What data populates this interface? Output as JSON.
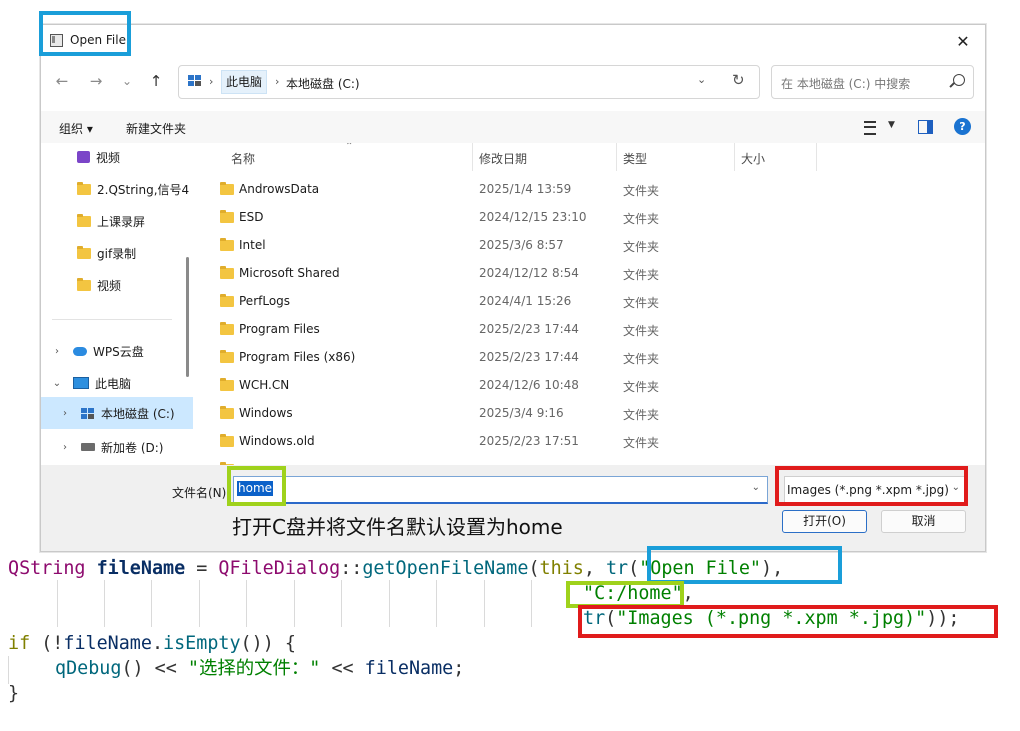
{
  "colors": {
    "highlight_blue": "#1a9ed9",
    "highlight_green": "#9fd21c",
    "highlight_red": "#e01b1b",
    "accent": "#0b61c9"
  },
  "dialog": {
    "title": "Open File",
    "close_glyph": "✕",
    "nav": {
      "back": "←",
      "forward": "→",
      "recent": "⌄",
      "up": "↑"
    },
    "address": {
      "crumbs": [
        "此电脑",
        "本地磁盘 (C:)"
      ],
      "separator": "›",
      "refresh": "↻",
      "dropdown": "⌄"
    },
    "search": {
      "placeholder": "在 本地磁盘 (C:) 中搜索"
    },
    "toolbar": {
      "organize": "组织 ▾",
      "new_folder": "新建文件夹",
      "help": "?"
    },
    "nav_pane": {
      "quick": [
        {
          "label": "视频",
          "icon": "video-icon",
          "pinned": true
        },
        {
          "label": "2.QString,信号4",
          "icon": "folder-icon"
        },
        {
          "label": "上课录屏",
          "icon": "folder-icon"
        },
        {
          "label": "gif录制",
          "icon": "folder-icon"
        },
        {
          "label": "视频",
          "icon": "folder-icon"
        }
      ],
      "tree": [
        {
          "label": "WPS云盘",
          "icon": "cloud-icon",
          "expander": "›"
        },
        {
          "label": "此电脑",
          "icon": "pc-icon",
          "expander": "⌄"
        },
        {
          "label": "本地磁盘 (C:)",
          "icon": "drive-c-icon",
          "expander": "›",
          "selected": true
        },
        {
          "label": "新加卷 (D:)",
          "icon": "drive-icon",
          "expander": "›"
        }
      ]
    },
    "columns": {
      "name": "名称",
      "date": "修改日期",
      "type": "类型",
      "size": "大小"
    },
    "files": [
      {
        "name": "AndrowsData",
        "date": "2025/1/4 13:59",
        "type": "文件夹"
      },
      {
        "name": "ESD",
        "date": "2024/12/15 23:10",
        "type": "文件夹"
      },
      {
        "name": "Intel",
        "date": "2025/3/6 8:57",
        "type": "文件夹"
      },
      {
        "name": "Microsoft Shared",
        "date": "2024/12/12 8:54",
        "type": "文件夹"
      },
      {
        "name": "PerfLogs",
        "date": "2024/4/1 15:26",
        "type": "文件夹"
      },
      {
        "name": "Program Files",
        "date": "2025/2/23 17:44",
        "type": "文件夹"
      },
      {
        "name": "Program Files (x86)",
        "date": "2025/2/23 17:44",
        "type": "文件夹"
      },
      {
        "name": "WCH.CN",
        "date": "2024/12/6 10:48",
        "type": "文件夹"
      },
      {
        "name": "Windows",
        "date": "2025/3/4 9:16",
        "type": "文件夹"
      },
      {
        "name": "Windows.old",
        "date": "2025/2/23 17:51",
        "type": "文件夹"
      }
    ],
    "filename_label": "文件名(N):",
    "filename_value": "home",
    "filter_value": "Images (*.png *.xpm *.jpg)",
    "open_button": "打开(O)",
    "cancel_button": "取消",
    "caption": "打开C盘并将文件名默认设置为home"
  },
  "code": {
    "l1": {
      "a": "QString",
      "b": "fileName",
      "c": " = ",
      "d": "QFileDialog",
      "e": "::",
      "f": "getOpenFileName",
      "g": "(",
      "h": "this",
      "i": ", ",
      "j": "tr",
      "k": "(",
      "l": "\"Open File\"",
      "m": "),"
    },
    "l2": {
      "a": "\"C:/home\"",
      "b": ","
    },
    "l3": {
      "a": "tr",
      "b": "(",
      "c": "\"Images (*.png *.xpm *.jpg)\"",
      "d": "));"
    },
    "l4": {
      "a": "if",
      "b": " (!",
      "c": "fileName",
      "d": ".",
      "e": "isEmpty",
      "f": "()) {"
    },
    "l5": {
      "a": "qDebug",
      "b": "() << ",
      "c": "\"选择的文件：\"",
      "d": " << ",
      "e": "fileName",
      "f": ";"
    },
    "l6": {
      "a": "}"
    }
  }
}
